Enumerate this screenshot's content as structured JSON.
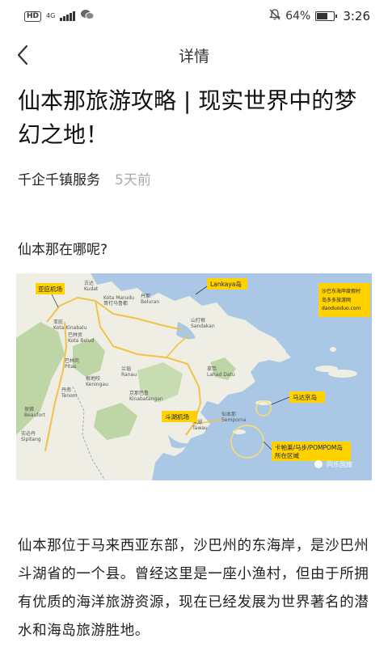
{
  "status_bar": {
    "hd": "HD",
    "network": "4G",
    "battery": "64%",
    "battery_level": 0.64,
    "time": "3:26",
    "icons": [
      "hd-icon",
      "signal-icon",
      "wechat-icon",
      "mute-bell-icon",
      "battery-icon"
    ]
  },
  "nav": {
    "title": "详情",
    "back_icon": "chevron-left-icon"
  },
  "article": {
    "title": "仙本那旅游攻略 | 现实世界中的梦幻之地！",
    "author": "千企千镇服务",
    "time_ago": "5天前",
    "section_heading": "仙本那在哪呢?",
    "body": "仙本那位于马来西亚东部，沙巴州的东海岸，是沙巴州斗湖省的一个县。曾经这里是一座小渔村，但由于所拥有优质的海洋旅游资源，现在已经发展为世界著名的潜水和海岛旅游胜地。"
  },
  "map": {
    "callouts": {
      "airport_kk": "亚庇机场",
      "lankaya": "Lankaya岛",
      "mataking": "马达京岛",
      "tawau_airport": "斗湖机场",
      "pompom": "卡帕莱/马步/POMPOM岛",
      "pompom_2": "所在区域"
    },
    "watermark_box": [
      "沙巴东海岸度假村",
      "岛多多旅游网",
      "daoduoduo.com"
    ],
    "watermark_bottom": "同乐国旅",
    "places": [
      "亚庇",
      "Kota Kinabalu",
      "古达",
      "Kudat",
      "Kota Marudu",
      "哥打马鲁都",
      "丹南",
      "Tenom",
      "保佛",
      "Beaufort",
      "山打根",
      "Sandakan",
      "拿笃",
      "Lahad Datu",
      "斗湖",
      "Tawau",
      "仙本那",
      "Semporna",
      "京那巴鲁",
      "Kinabatangan",
      "巴林岗",
      "Pitas",
      "根地咬",
      "Keningau",
      "兰瑙",
      "Ranau",
      "丹那",
      "Beluran",
      "实必丹",
      "Sipitang",
      "巴林贡",
      "Kota Belud"
    ],
    "colors": {
      "sea": "#aac8e6",
      "land": "#eeeee4",
      "forest": "#bed5a6",
      "road": "#f3c24a",
      "callout": "#ffd200"
    }
  }
}
